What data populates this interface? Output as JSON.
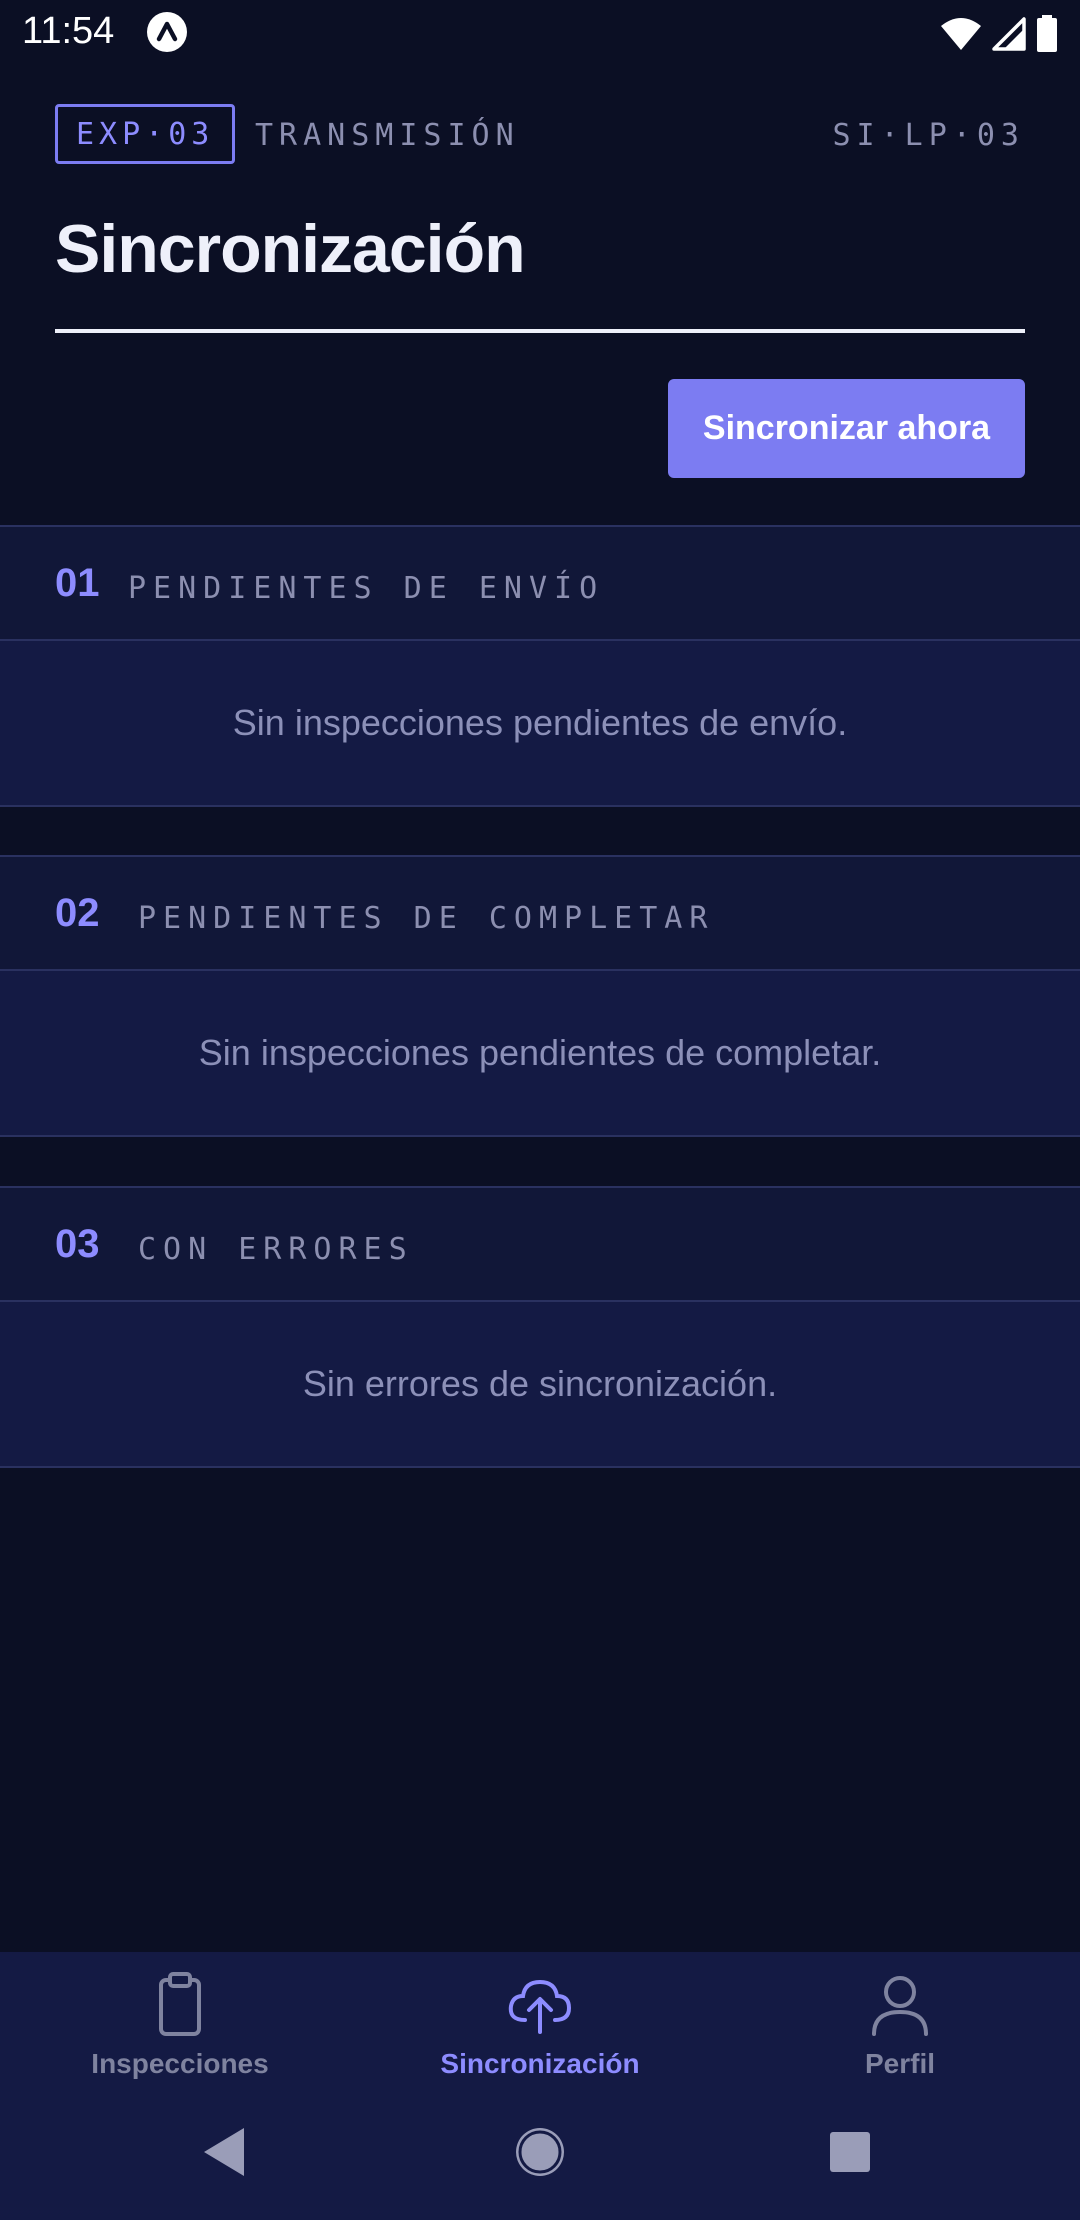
{
  "status_bar": {
    "time": "11:54"
  },
  "header": {
    "badge": "EXP·03",
    "label": "TRANSMISIÓN",
    "code": "SI·LP·03",
    "title": "Sincronización"
  },
  "actions": {
    "sync_now": "Sincronizar ahora"
  },
  "sections": [
    {
      "number": "01",
      "label": "PENDIENTES DE ENVÍO",
      "empty_message": "Sin inspecciones pendientes de envío."
    },
    {
      "number": "02",
      "label": "PENDIENTES DE COMPLETAR",
      "empty_message": "Sin inspecciones pendientes de completar."
    },
    {
      "number": "03",
      "label": "CON ERRORES",
      "empty_message": "Sin errores de sincronización."
    }
  ],
  "bottom_nav": {
    "items": [
      {
        "label": "Inspecciones",
        "icon": "clipboard-icon",
        "active": false
      },
      {
        "label": "Sincronización",
        "icon": "cloud-upload-icon",
        "active": true
      },
      {
        "label": "Perfil",
        "icon": "person-icon",
        "active": false
      }
    ]
  },
  "colors": {
    "background": "#0b0f24",
    "accent": "#7c7cf2",
    "panel": "#141a44",
    "muted_text": "#8c8fb0"
  }
}
